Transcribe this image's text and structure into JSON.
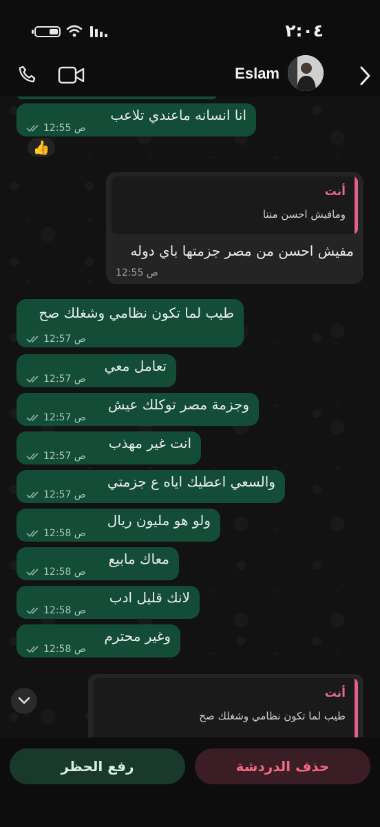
{
  "status_bar": {
    "time": "٢:٠٤"
  },
  "header": {
    "contact_name": "Eslam"
  },
  "pinned_reaction": "👍",
  "messages": [
    {
      "text": "انا انسانه ماعندي تلاعب",
      "time": "12:55 ص"
    },
    {
      "text": "طيب لما تكون نظامي وشغلك صح",
      "time": "12:57 ص"
    },
    {
      "text": "تعامل معي",
      "time": "12:57 ص"
    },
    {
      "text": "وجزمة مصر توكلك عيش",
      "time": "12:57 ص"
    },
    {
      "text": "انت غير مهذب",
      "time": "12:57 ص"
    },
    {
      "text": "والسعي اعطيك اياه ع جزمتي",
      "time": "12:57 ص"
    },
    {
      "text": "ولو هو مليون ريال",
      "time": "12:58 ص"
    },
    {
      "text": "معاك مابيع",
      "time": "12:58 ص"
    },
    {
      "text": "لانك قليل ادب",
      "time": "12:58 ص"
    },
    {
      "text": "وغير محترم",
      "time": "12:58 ص"
    }
  ],
  "outgoing": {
    "quote_author": "أنت",
    "quote_text": "ومافيش احسن مننا",
    "text": "مفيش احسن من مصر جزمتها باي دوله",
    "time": "12:55 ص"
  },
  "reply_preview": {
    "quote_author": "أنت",
    "quote_text": "طيب لما تكون نظامي وشغلك صح"
  },
  "actions": {
    "unblock_label": "رفع الحظر",
    "delete_chat_label": "حذف الدردشة"
  },
  "colors": {
    "incoming_bubble": "#144d37",
    "outgoing_bubble": "#242424",
    "quote_accent": "#e25f8c",
    "delete_text": "#f06a84"
  }
}
